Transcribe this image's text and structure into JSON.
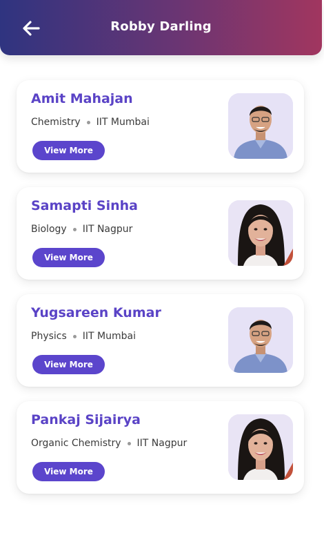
{
  "header": {
    "title": "Robby Darling",
    "back_icon": "arrow-left-icon"
  },
  "cards": [
    {
      "name": "Amit Mahajan",
      "subject": "Chemistry",
      "institute": "IIT Mumbai",
      "button": "View More",
      "avatar": "male-teacher-photo"
    },
    {
      "name": "Samapti Sinha",
      "subject": "Biology",
      "institute": "IIT Nagpur",
      "button": "View More",
      "avatar": "female-teacher-photo"
    },
    {
      "name": "Yugsareen Kumar",
      "subject": "Physics",
      "institute": "IIT Mumbai",
      "button": "View More",
      "avatar": "male-teacher-photo"
    },
    {
      "name": "Pankaj Sijairya",
      "subject": "Organic Chemistry",
      "institute": "IIT Nagpur",
      "button": "View More",
      "avatar": "female-teacher-photo"
    }
  ],
  "colors": {
    "header_gradient_start": "#2f3480",
    "header_gradient_end": "#a1365f",
    "accent": "#5b45cc",
    "name_text": "#5a43c6"
  }
}
